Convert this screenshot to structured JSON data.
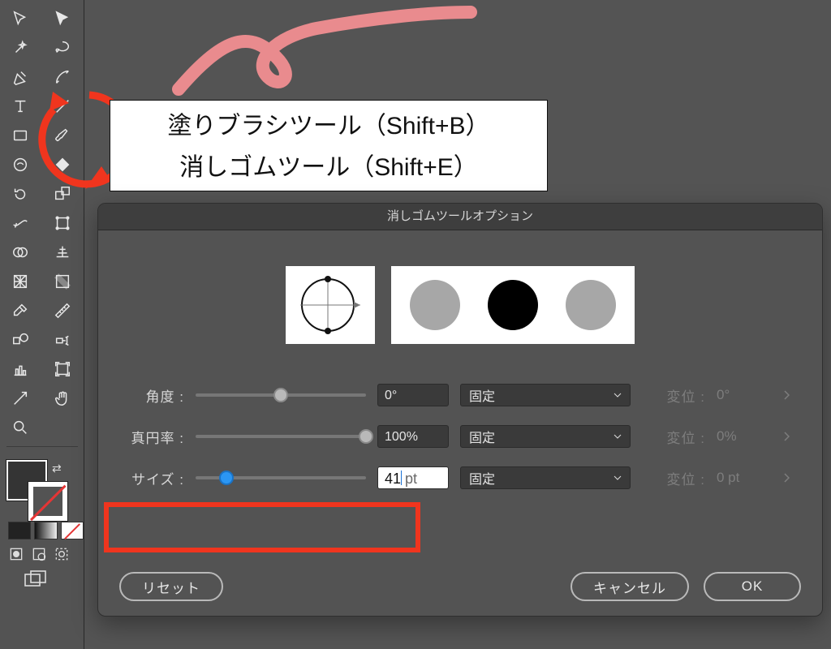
{
  "tooltip": {
    "blob": "塗りブラシツール（Shift+B）",
    "eraser": "消しゴムツール（Shift+E）"
  },
  "dialog": {
    "title": "消しゴムツールオプション",
    "angle": {
      "label": "角度 :",
      "value": "0°",
      "slider_pct": 50,
      "mode": "固定",
      "var_label": "変位 :",
      "var_value": "0°"
    },
    "roundness": {
      "label": "真円率 :",
      "value": "100%",
      "slider_pct": 100,
      "mode": "固定",
      "var_label": "変位 :",
      "var_value": "0%"
    },
    "size": {
      "label": "サイズ :",
      "value": "41",
      "unit": "pt",
      "slider_pct": 18,
      "mode": "固定",
      "var_label": "変位 :",
      "var_value": "0 pt"
    },
    "buttons": {
      "reset": "リセット",
      "cancel": "キャンセル",
      "ok": "OK"
    }
  }
}
